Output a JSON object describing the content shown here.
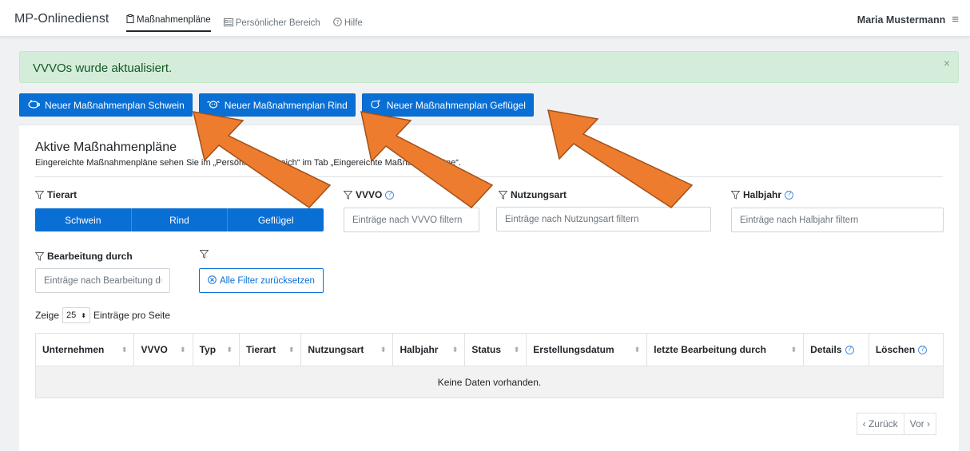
{
  "nav": {
    "brand": "MP-Onlinedienst",
    "items": [
      {
        "label": "Maßnahmenpläne",
        "icon": "clipboard-icon",
        "active": true
      },
      {
        "label": "Persönlicher Bereich",
        "icon": "id-card-icon",
        "active": false
      },
      {
        "label": "Hilfe",
        "icon": "question-circle-icon",
        "active": false
      }
    ],
    "user": "Maria Mustermann",
    "menu_icon": "hamburger-icon"
  },
  "alert": {
    "text": "VVVOs wurde aktualisiert.",
    "close": "×",
    "color": "#d4edda"
  },
  "actions": [
    {
      "label": "Neuer Maßnahmenplan Schwein",
      "icon": "pig-icon"
    },
    {
      "label": "Neuer Maßnahmenplan Rind",
      "icon": "cow-icon"
    },
    {
      "label": "Neuer Maßnahmenplan Geflügel",
      "icon": "bird-icon"
    }
  ],
  "card": {
    "title": "Aktive Maßnahmenpläne",
    "subtitle": "Eingereichte Maßnahmenpläne sehen Sie im „Persönlicher Bereich“ im Tab „Eingereichte Maßnahmenpläne“."
  },
  "filters": {
    "tierart": {
      "label": "Tierart",
      "options": [
        "Schwein",
        "Rind",
        "Geflügel"
      ]
    },
    "vvvo": {
      "label": "VVVO",
      "placeholder": "Einträge nach VVVO filtern"
    },
    "nutzungsart": {
      "label": "Nutzungsart",
      "placeholder": "Einträge nach Nutzungsart filtern"
    },
    "halbjahr": {
      "label": "Halbjahr",
      "placeholder": "Einträge nach Halbjahr filtern"
    },
    "bearbeitung": {
      "label": "Bearbeitung durch",
      "placeholder": "Einträge nach Bearbeitung durch filtern"
    },
    "reset": "Alle Filter zurücksetzen"
  },
  "page_size": {
    "prefix": "Zeige",
    "value": "25",
    "suffix": "Einträge pro Seite"
  },
  "table": {
    "columns": [
      "Unternehmen",
      "VVVO",
      "Typ",
      "Tierart",
      "Nutzungsart",
      "Halbjahr",
      "Status",
      "Erstellungsdatum",
      "letzte Bearbeitung durch",
      "Details",
      "Löschen"
    ],
    "empty": "Keine Daten vorhanden."
  },
  "pagination": {
    "prev": "‹ Zurück",
    "next": "Vor ›"
  },
  "colors": {
    "primary": "#0a6fd4",
    "arrow": "#ee7c2f",
    "success_bg": "#d4edda"
  }
}
